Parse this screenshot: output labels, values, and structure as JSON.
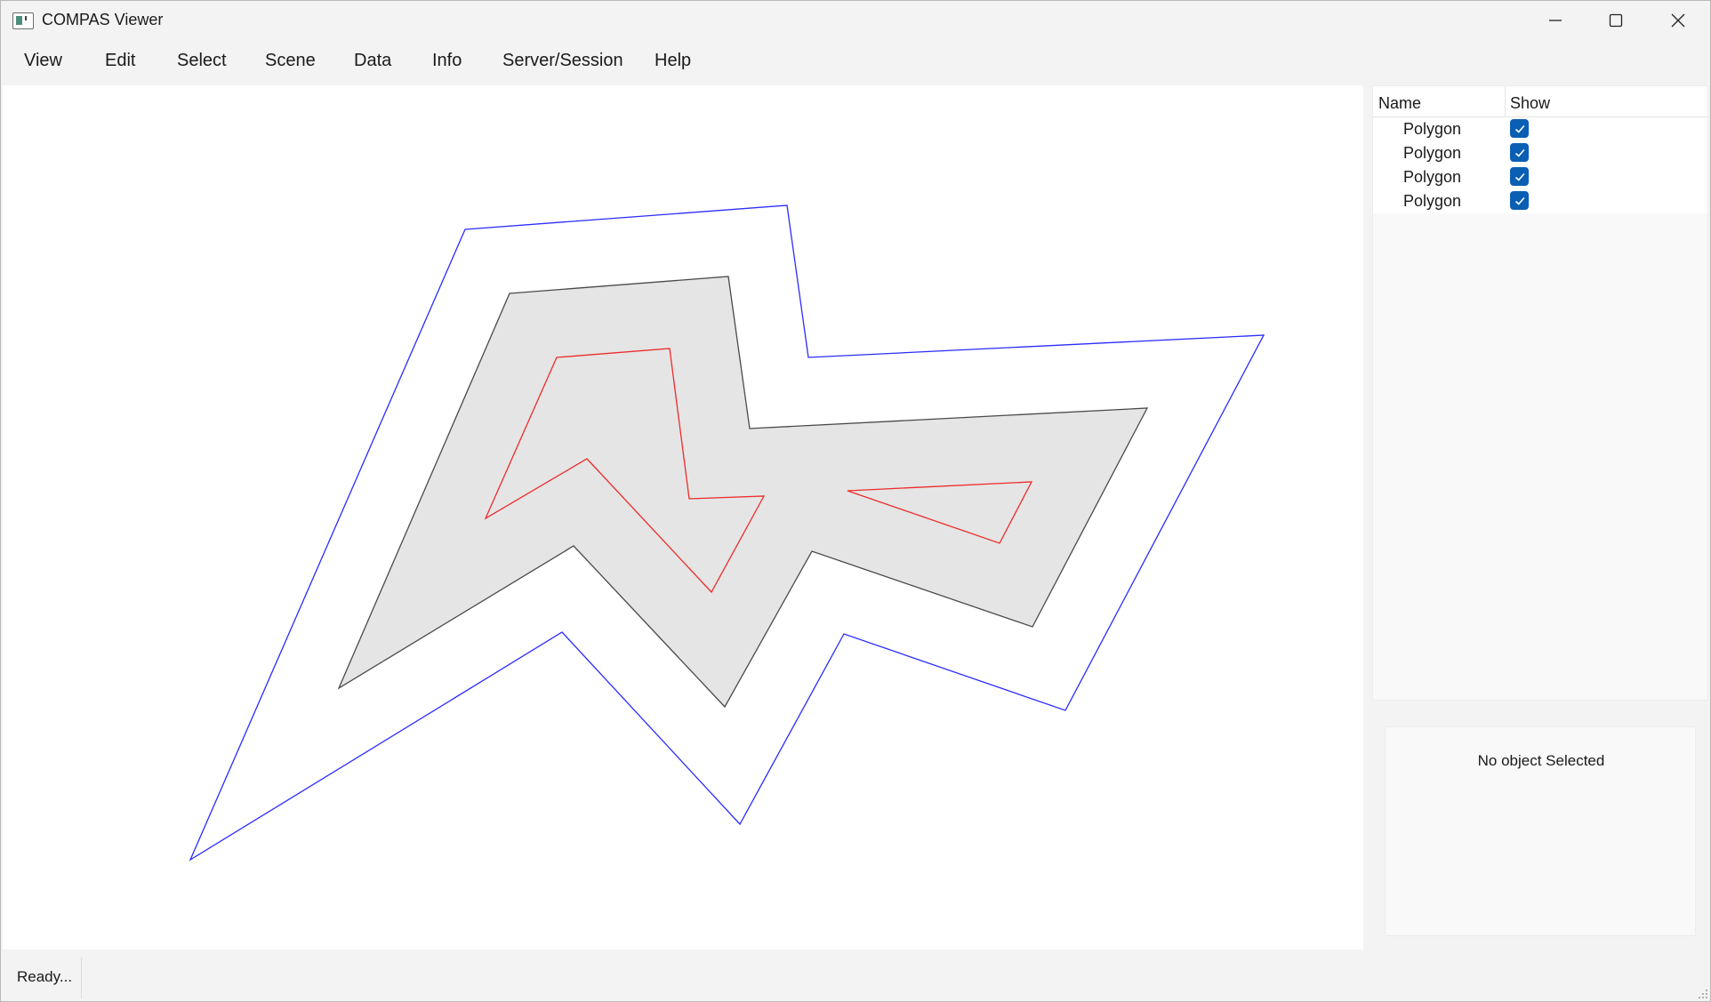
{
  "window": {
    "title": "COMPAS Viewer"
  },
  "menu": [
    "View",
    "Edit",
    "Select",
    "Scene",
    "Data",
    "Info",
    "Server/Session",
    "Help"
  ],
  "scene_tree": {
    "columns": {
      "name": "Name",
      "show": "Show"
    },
    "items": [
      {
        "name": "Polygon",
        "show": true
      },
      {
        "name": "Polygon",
        "show": true
      },
      {
        "name": "Polygon",
        "show": true
      },
      {
        "name": "Polygon",
        "show": true
      }
    ]
  },
  "properties": {
    "empty_text": "No object Selected"
  },
  "status": {
    "text": "Ready..."
  },
  "colors": {
    "outer_polygon_stroke": "#2b2bff",
    "middle_polygon_stroke": "#4a4a4a",
    "middle_polygon_fill": "#e5e5e5",
    "inner_polygon_stroke": "#ee2b2b",
    "checkbox": "#0a5fb4"
  }
}
